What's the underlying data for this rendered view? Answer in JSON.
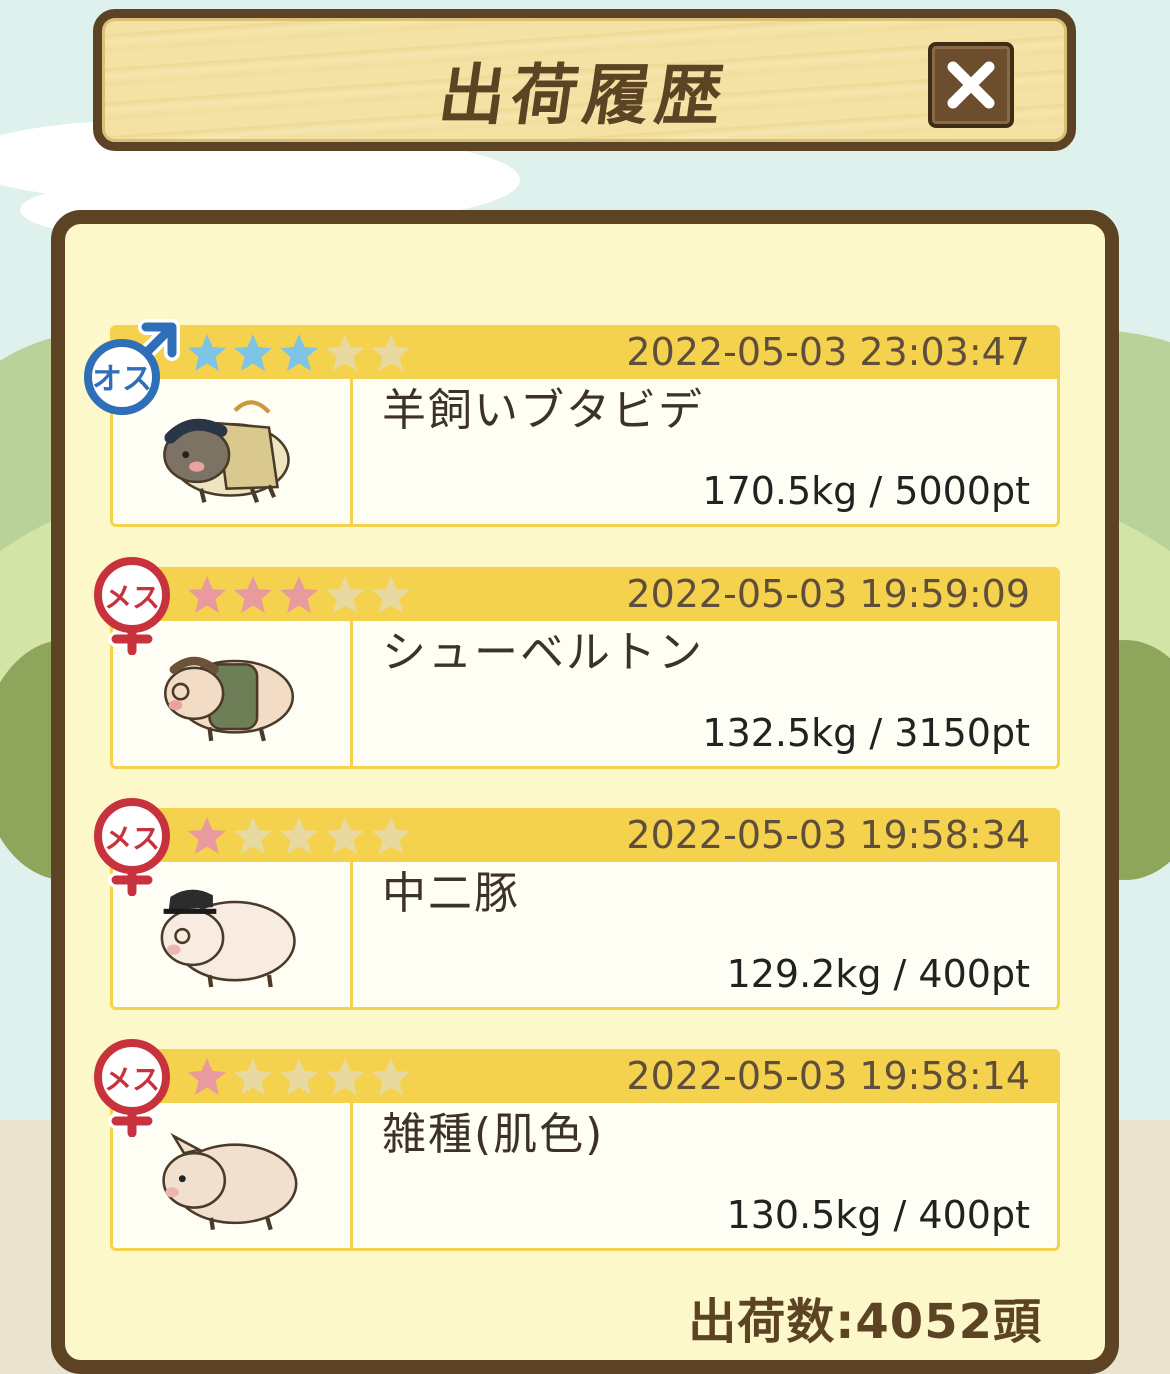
{
  "header": {
    "title": "出荷履歴",
    "close_icon": "close-x-icon"
  },
  "history": [
    {
      "gender": "male",
      "gender_label": "オス",
      "rating": 3,
      "star_color": "#7ec4e6",
      "timestamp": "2022-05-03 23:03:47",
      "name": "羊飼いブタビデ",
      "stats": "170.5kg / 5000pt",
      "icon": "shepherd-pig-icon"
    },
    {
      "gender": "female",
      "gender_label": "メス",
      "rating": 3,
      "star_color": "#e99a9e",
      "timestamp": "2022-05-03 19:59:09",
      "name": "シューベルトン",
      "stats": "132.5kg / 3150pt",
      "icon": "composer-pig-icon"
    },
    {
      "gender": "female",
      "gender_label": "メス",
      "rating": 1,
      "star_color": "#e99a9e",
      "timestamp": "2022-05-03 19:58:34",
      "name": "中二豚",
      "stats": "129.2kg / 400pt",
      "icon": "cap-pig-icon"
    },
    {
      "gender": "female",
      "gender_label": "メス",
      "rating": 1,
      "star_color": "#e99a9e",
      "timestamp": "2022-05-03 19:58:14",
      "name": "雑種(肌色)",
      "stats": "130.5kg / 400pt",
      "icon": "plain-pig-icon"
    }
  ],
  "footer": {
    "total": "出荷数:4052頭"
  },
  "colors": {
    "frame": "#5c4324",
    "panel": "#fdf8c9",
    "row_header": "#f5d24d",
    "male": "#2f6fb7",
    "female": "#c8323c",
    "empty_star": "#e8d9a0"
  }
}
